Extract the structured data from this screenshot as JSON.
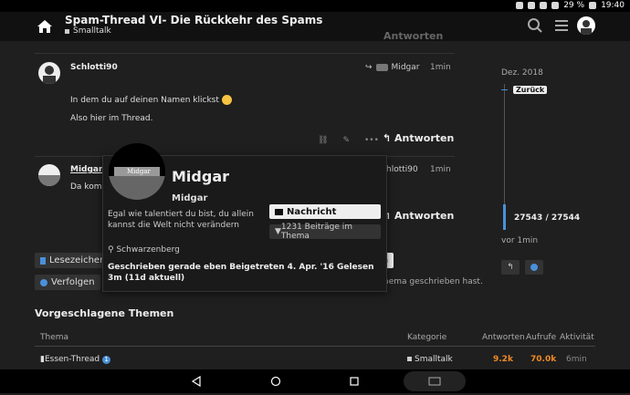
{
  "status": {
    "battery": "29 %",
    "time": "19:40"
  },
  "header": {
    "title": "Spam-Thread VI- Die Rückkehr des Spams",
    "category": "Smalltalk"
  },
  "ghost_reply": "Antworten",
  "post1": {
    "username": "Schlotti90",
    "reply_to": "Midgar",
    "time": "1min",
    "line1": "In dem du auf deinen Namen klickst",
    "line2": "Also hier im Thread.",
    "reply": "Antworten"
  },
  "post2": {
    "username": "Midgar",
    "preview": "Da komm",
    "reply_to": "hlotti90",
    "time": "1min",
    "reply": "Antworten"
  },
  "buttons": {
    "bookmark": "Lesezeichen",
    "follow": "Verfolgen",
    "white_btn": "n",
    "note": "hema geschrieben hast."
  },
  "suggested": {
    "title": "Vorgeschlagene Themen",
    "headers": {
      "topic": "Thema",
      "category": "Kategorie",
      "replies": "Antworten",
      "views": "Aufrufe",
      "activity": "Aktivität"
    },
    "rows": [
      {
        "topic": "Essen-Thread",
        "badge": "1",
        "category": "Smalltalk",
        "replies": "9.2k",
        "views": "70.0k",
        "activity": "6min"
      }
    ]
  },
  "timeline": {
    "date": "Dez. 2018",
    "back": "Zurück",
    "progress": "27543 / 27544",
    "ago": "vor 1min"
  },
  "card": {
    "avatar_caption": "Midgar",
    "name": "Midgar",
    "username": "Midgar",
    "bio": "Egal wie talentiert du bist, du allein kannst die Welt nicht verändern",
    "message": "Nachricht",
    "posts": "1231 Beiträge im Thema",
    "location": "Schwarzenberg",
    "meta": "Geschrieben gerade eben   Beigetreten 4. Apr. '16   Gelesen 3m (11d aktuell)"
  },
  "colors": {
    "accent": "#4a90d9",
    "orange": "#f08a24"
  }
}
